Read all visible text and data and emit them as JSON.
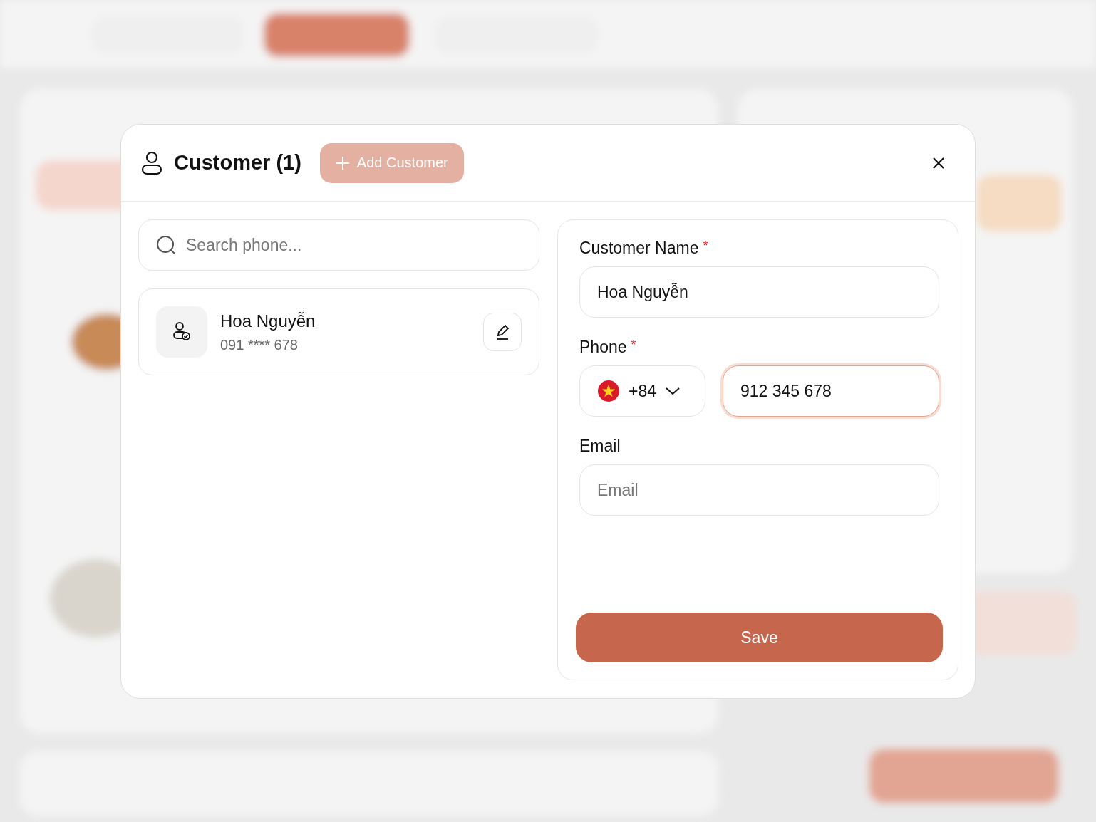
{
  "dialog": {
    "title": "Customer (1)",
    "add_button": "Add Customer"
  },
  "search": {
    "placeholder": "Search phone..."
  },
  "customers": [
    {
      "name": "Hoa Nguyễn",
      "phone": "091 **** 678"
    }
  ],
  "form": {
    "name_label": "Customer Name",
    "name_required": true,
    "name_value": "Hoa Nguyễn",
    "phone_label": "Phone",
    "phone_required": true,
    "country_code": "+84",
    "phone_value": "912 345 678",
    "phone_focused": true,
    "email_label": "Email",
    "email_required": false,
    "email_placeholder": "Email",
    "required_mark": "*",
    "save_button": "Save"
  }
}
